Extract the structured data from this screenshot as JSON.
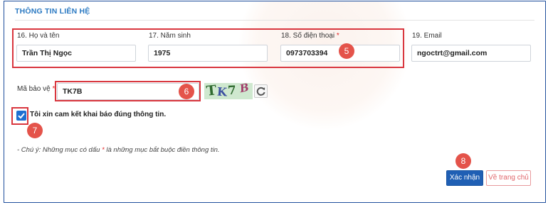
{
  "section": {
    "title": "THÔNG TIN LIÊN HỆ"
  },
  "fields": {
    "name": {
      "label": "16. Họ và tên",
      "value": "Trần Thị Ngọc"
    },
    "birth_year": {
      "label": "17. Năm sinh",
      "value": "1975"
    },
    "phone": {
      "label": "18. Số điện thoại",
      "required_mark": "*",
      "value": "0973703394"
    },
    "email": {
      "label": "19. Email",
      "value": "ngoctrt@gmail.com"
    }
  },
  "captcha": {
    "label": "Mã bảo vệ",
    "required_mark": "*",
    "value": "TK7B",
    "image_chars": [
      "T",
      "K",
      "7",
      "B"
    ],
    "refresh_icon": "refresh-icon"
  },
  "agreement": {
    "checked": true,
    "text": "Tôi xin cam kết khai báo đúng thông tin."
  },
  "note": {
    "before": "- Chú ý: Những mục có dấu ",
    "mark": "*",
    "after": " là những mục bắt buộc điền thông tin."
  },
  "buttons": {
    "confirm": "Xác nhận",
    "home": "Về trang chủ"
  },
  "step_markers": {
    "contact_fields": "5",
    "captcha": "6",
    "agreement": "7",
    "confirm": "8"
  },
  "colors": {
    "accent": "#2a79c2",
    "primary_button": "#1f5fb4",
    "highlight_red": "#d9363e",
    "checkbox": "#1f6fd1"
  }
}
